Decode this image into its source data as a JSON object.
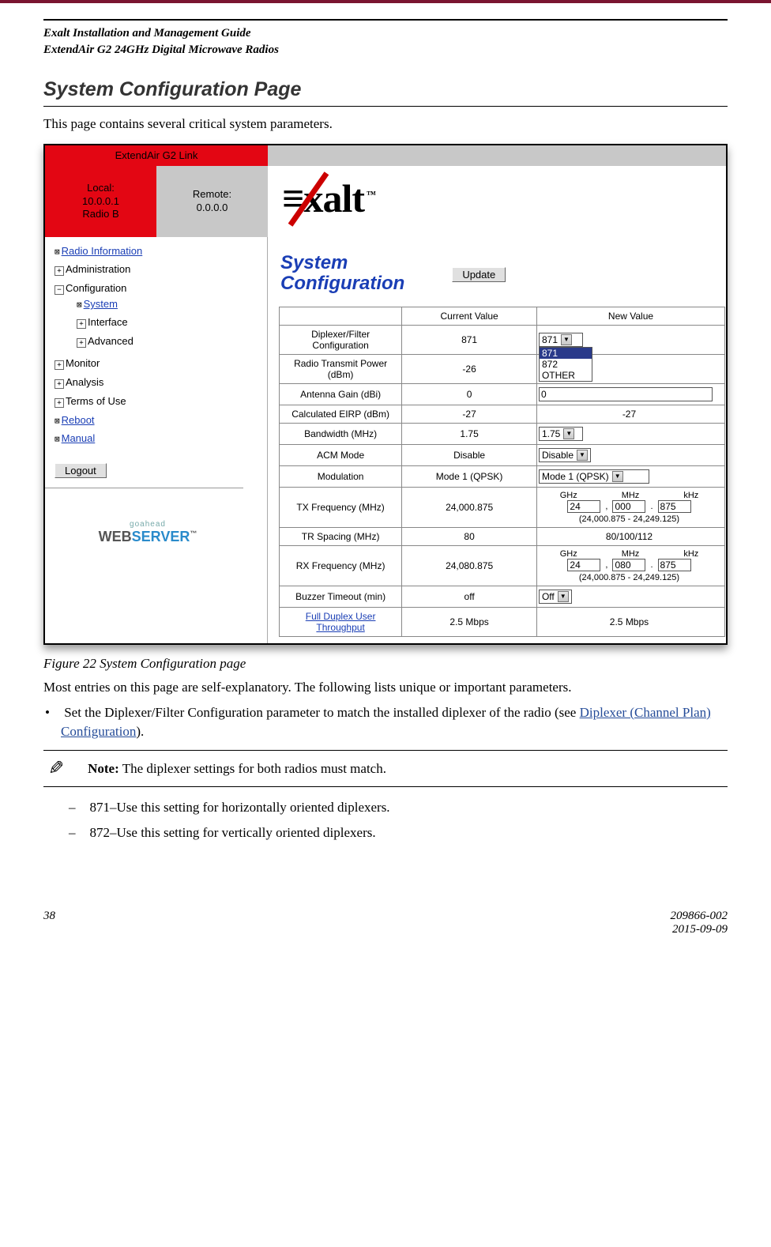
{
  "doc": {
    "header_line1": "Exalt Installation and Management Guide",
    "header_line2": "ExtendAir G2 24GHz Digital Microwave Radios",
    "section_title": "System Configuration Page",
    "intro": "This page contains several critical system parameters.",
    "figure_caption": "Figure 22   System Configuration page",
    "p_after": "Most entries on this page are self-explanatory. The following lists unique or important parameters.",
    "bullet1a": "Set the Diplexer/Filter Configuration parameter to match the installed diplexer of the radio (see ",
    "bullet1_link": "Diplexer (Channel Plan) Configuration",
    "bullet1b": ").",
    "note_bold": "Note:",
    "note_text": " The diplexer settings for both radios must match.",
    "dash1": "871–Use this setting for horizontally oriented diplexers.",
    "dash2": "872–Use this setting for vertically oriented diplexers."
  },
  "footer": {
    "page": "38",
    "docnum": "209866-002",
    "date": "2015-09-09"
  },
  "ui": {
    "linkname": "ExtendAir G2 Link",
    "local_label": "Local:",
    "local_ip": "10.0.0.1",
    "local_radio": "Radio B",
    "remote_label": "Remote:",
    "remote_ip": "0.0.0.0",
    "nav": {
      "radio_info": "Radio Information",
      "admin": "Administration",
      "config": "Configuration",
      "system": "System",
      "interface": "Interface",
      "advanced": "Advanced",
      "monitor": "Monitor",
      "analysis": "Analysis",
      "terms": "Terms of Use",
      "reboot": "Reboot",
      "manual": "Manual"
    },
    "logout": "Logout",
    "goahead": "goahead",
    "webserver_a": "WEB",
    "webserver_b": "SERVER",
    "panel_title": "System Configuration",
    "update": "Update",
    "cols": {
      "cur": "Current Value",
      "new": "New Value"
    },
    "rows": {
      "diplexer": {
        "name": "Diplexer/Filter Configuration",
        "cur": "871",
        "sel": "871",
        "opts": [
          "871",
          "872",
          "OTHER"
        ]
      },
      "txpower": {
        "name": "Radio Transmit Power (dBm)",
        "cur": "-26"
      },
      "antgain": {
        "name": "Antenna Gain (dBi)",
        "cur": "0",
        "input": "0"
      },
      "eirp": {
        "name": "Calculated EIRP (dBm)",
        "cur": "-27",
        "new": "-27"
      },
      "bw": {
        "name": "Bandwidth (MHz)",
        "cur": "1.75",
        "sel": "1.75"
      },
      "acm": {
        "name": "ACM Mode",
        "cur": "Disable",
        "sel": "Disable"
      },
      "mod": {
        "name": "Modulation",
        "cur": "Mode 1 (QPSK)",
        "sel": "Mode 1 (QPSK)"
      },
      "txfreq": {
        "name": "TX Frequency (MHz)",
        "cur": "24,000.875",
        "ghz": "24",
        "mhz": "000",
        "khz": "875",
        "range": "(24,000.875 - 24,249.125)"
      },
      "trspace": {
        "name": "TR Spacing (MHz)",
        "cur": "80",
        "new": "80/100/112"
      },
      "rxfreq": {
        "name": "RX Frequency (MHz)",
        "cur": "24,080.875",
        "ghz": "24",
        "mhz": "080",
        "khz": "875",
        "range": "(24,000.875 - 24,249.125)"
      },
      "buzzer": {
        "name": "Buzzer Timeout (min)",
        "cur": "off",
        "sel": "Off"
      },
      "thru": {
        "name": "Full Duplex User Throughput",
        "cur": "2.5 Mbps",
        "new": "2.5 Mbps"
      }
    },
    "freq_labels": {
      "ghz": "GHz",
      "mhz": "MHz",
      "khz": "kHz"
    }
  }
}
